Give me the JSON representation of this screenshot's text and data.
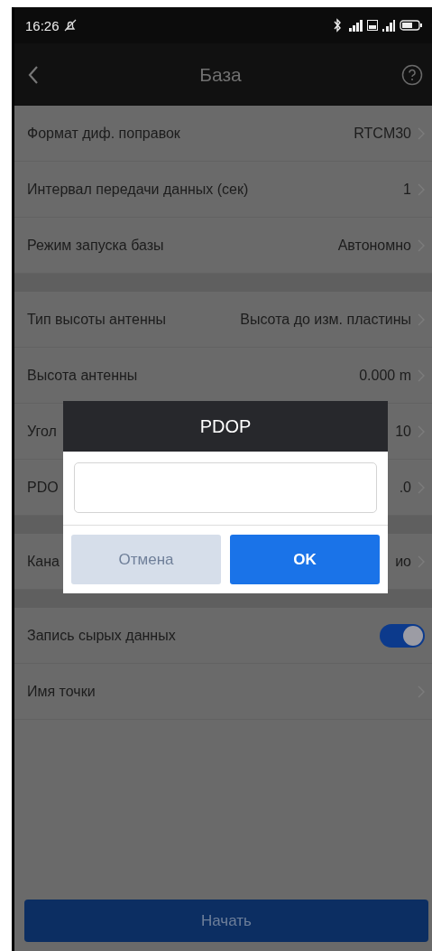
{
  "status_bar": {
    "time": "16:26"
  },
  "header": {
    "title": "База"
  },
  "sections": [
    {
      "rows": [
        {
          "kind": "value",
          "label": "Формат диф. поправок",
          "value": "RTCM30"
        },
        {
          "kind": "value",
          "label": "Интервал передачи данных (сек)",
          "value": "1"
        },
        {
          "kind": "value",
          "label": "Режим запуска базы",
          "value": "Автономно"
        }
      ]
    },
    {
      "rows": [
        {
          "kind": "value",
          "label": "Тип высоты антенны",
          "value": "Высота до изм. пластины"
        },
        {
          "kind": "value",
          "label": "Высота антенны",
          "value": "0.000 m"
        },
        {
          "kind": "value",
          "label": "Угол",
          "value": "10"
        },
        {
          "kind": "value",
          "label": "PDO",
          "value": ".0"
        }
      ]
    },
    {
      "rows": [
        {
          "kind": "value",
          "label": "Кана",
          "value": "ио"
        }
      ]
    },
    {
      "rows": [
        {
          "kind": "toggle",
          "label": "Запись сырых данных",
          "on": true
        },
        {
          "kind": "value",
          "label": "Имя точки",
          "value": ""
        }
      ]
    }
  ],
  "start_button": {
    "label": "Начать"
  },
  "dialog": {
    "title": "PDOP",
    "buttons": [
      {
        "label": "Отмена",
        "primary": false
      },
      {
        "label": "OK",
        "primary": true
      }
    ]
  }
}
